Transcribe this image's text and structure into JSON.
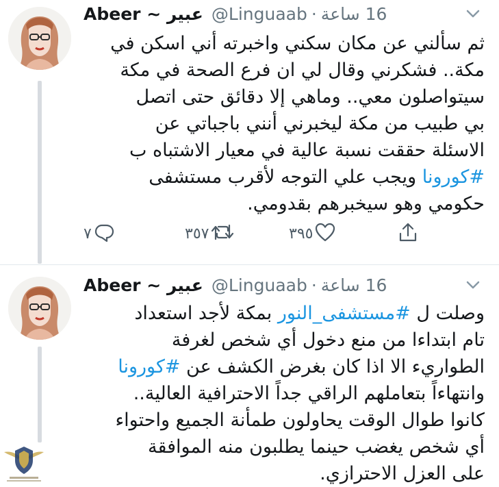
{
  "tweets": [
    {
      "display_name": "Abeer ~ عبير",
      "handle": "@Linguaab",
      "separator": "·",
      "time": "16 ساعة",
      "lines": [
        "ثم سألني عن مكان سكني واخبرته أني اسكن في",
        "مكة.. فشكرني وقال لي ان فرع الصحة في مكة",
        "سيتواصلون معي.. وماهي إلا دقائق حتى اتصل",
        "بي طبيب من مكة ليخبرني أنني باجباتي عن",
        "الاسئلة حققت نسبة عالية في معيار الاشتباه ب"
      ],
      "hashtag_line": {
        "hashtag": "#كورونا",
        "rest": " ويجب علي التوجه لأقرب مستشفى"
      },
      "last_line": "حكومي وهو سيخبرهم بقدومي.",
      "replies": "٧",
      "retweets": "٣٥٧",
      "likes": "٣٩٥"
    },
    {
      "display_name": "Abeer ~ عبير",
      "handle": "@Linguaab",
      "separator": "·",
      "time": "16 ساعة",
      "line1": {
        "prefix": "وصلت ل ",
        "hashtag": "#مستشفى_النور",
        "rest": " بمكة لأجد استعداد"
      },
      "line2": "تام ابتداءا من منع دخول أي شخص لغرفة",
      "line3": {
        "prefix": "الطواريء الا اذا كان بغرض الكشف عن ",
        "hashtag": "#كورونا"
      },
      "line4": "وانتهاءاً بتعاملهم الراقي جداً الاحترافية العالية..",
      "line5": "كانوا طوال الوقت يحاولون طمأنة الجميع واحتواء",
      "line6": "أي شخص يغضب حينما يطلبون منه الموافقة",
      "line7": "على العزل الاحترازي."
    }
  ],
  "icons": {
    "reply": "reply-icon",
    "retweet": "retweet-icon",
    "like": "like-icon",
    "share": "share-icon",
    "caret": "chevron-down-icon",
    "watermark": "shield-logo-icon"
  },
  "colors": {
    "hashtag": "#1b95e0",
    "secondary_text": "#66757f",
    "thread_line": "#d7dbe0"
  }
}
